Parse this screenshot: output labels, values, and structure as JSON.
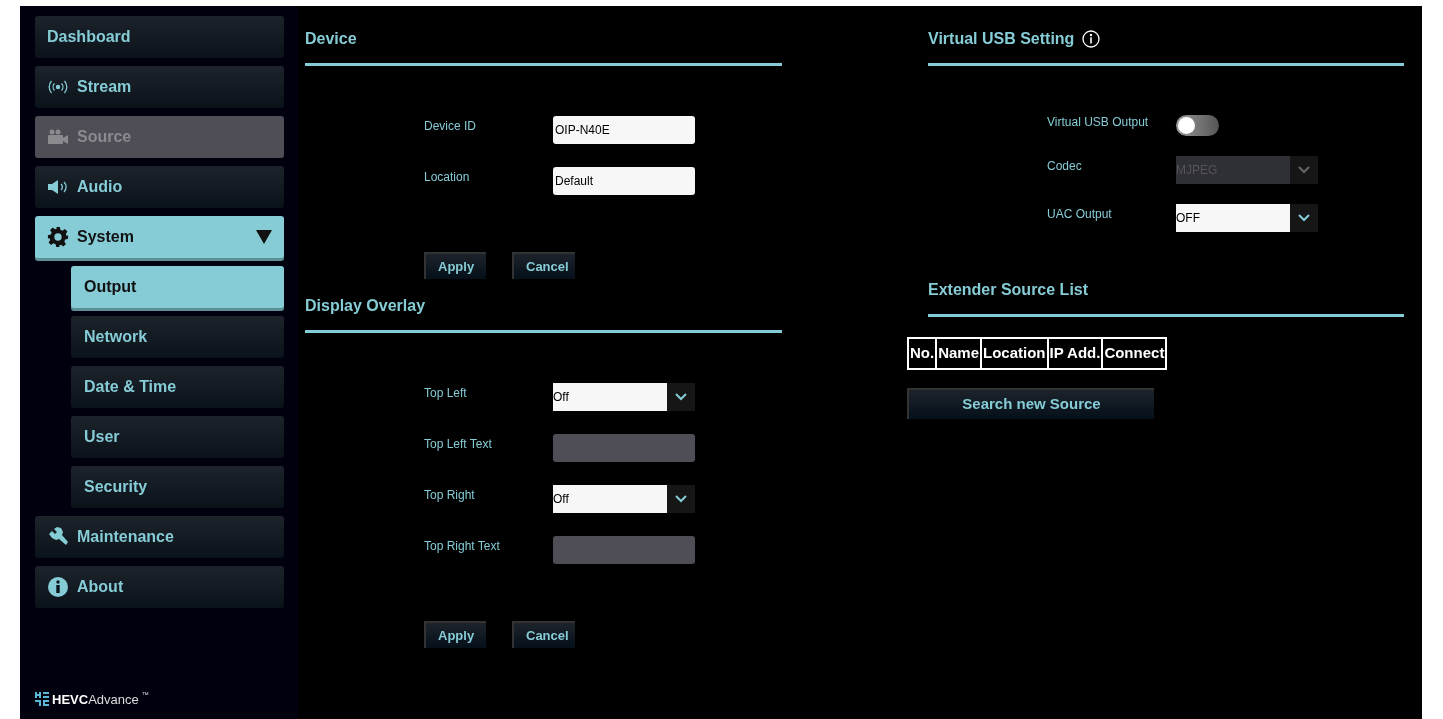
{
  "sidebar": {
    "items": [
      {
        "label": "Dashboard",
        "selected": false,
        "disabled": false
      },
      {
        "label": "Stream",
        "selected": false,
        "disabled": false
      },
      {
        "label": "Source",
        "selected": false,
        "disabled": true
      },
      {
        "label": "Audio",
        "selected": false,
        "disabled": false
      },
      {
        "label": "System",
        "selected": true,
        "disabled": false,
        "expanded": true,
        "children": [
          {
            "label": "Output",
            "selected": true
          },
          {
            "label": "Network",
            "selected": false
          },
          {
            "label": "Date & Time",
            "selected": false
          },
          {
            "label": "User",
            "selected": false
          },
          {
            "label": "Security",
            "selected": false
          }
        ]
      },
      {
        "label": "Maintenance",
        "selected": false,
        "disabled": false
      },
      {
        "label": "About",
        "selected": false,
        "disabled": false
      }
    ],
    "logo": {
      "brand": "HEVC",
      "word": "Advance",
      "mark": "™"
    }
  },
  "device": {
    "title": "Device",
    "fields": [
      {
        "label": "Device ID",
        "kind": "text",
        "value": "OIP-N40E",
        "disabled": false
      },
      {
        "label": "Location",
        "kind": "text",
        "value": "Default",
        "disabled": false
      }
    ],
    "buttons": [
      "Apply",
      "Cancel"
    ]
  },
  "display_overlay": {
    "title": "Display Overlay",
    "fields": [
      {
        "label": "Top Left",
        "kind": "select",
        "value": "Off",
        "disabled": false
      },
      {
        "label": "Top Left Text",
        "kind": "text",
        "disabled": true
      },
      {
        "label": "Top Right",
        "kind": "select",
        "value": "Off",
        "disabled": false
      },
      {
        "label": "Top Right Text",
        "kind": "text",
        "disabled": true
      }
    ],
    "buttons": [
      "Apply",
      "Cancel"
    ]
  },
  "virtual_usb": {
    "title": "Virtual USB Setting",
    "fields": [
      {
        "label": "Virtual USB Output",
        "kind": "toggle",
        "on": false
      },
      {
        "label": "Codec",
        "kind": "select",
        "value": "MJPEG",
        "disabled": true
      },
      {
        "label": "UAC Output",
        "kind": "select",
        "value": "OFF",
        "disabled": false
      }
    ]
  },
  "extender": {
    "title": "Extender Source List",
    "table": {
      "columns": [
        "No.",
        "Name",
        "Location",
        "IP Add.",
        "Connect"
      ]
    },
    "button": "Search new Source"
  }
}
